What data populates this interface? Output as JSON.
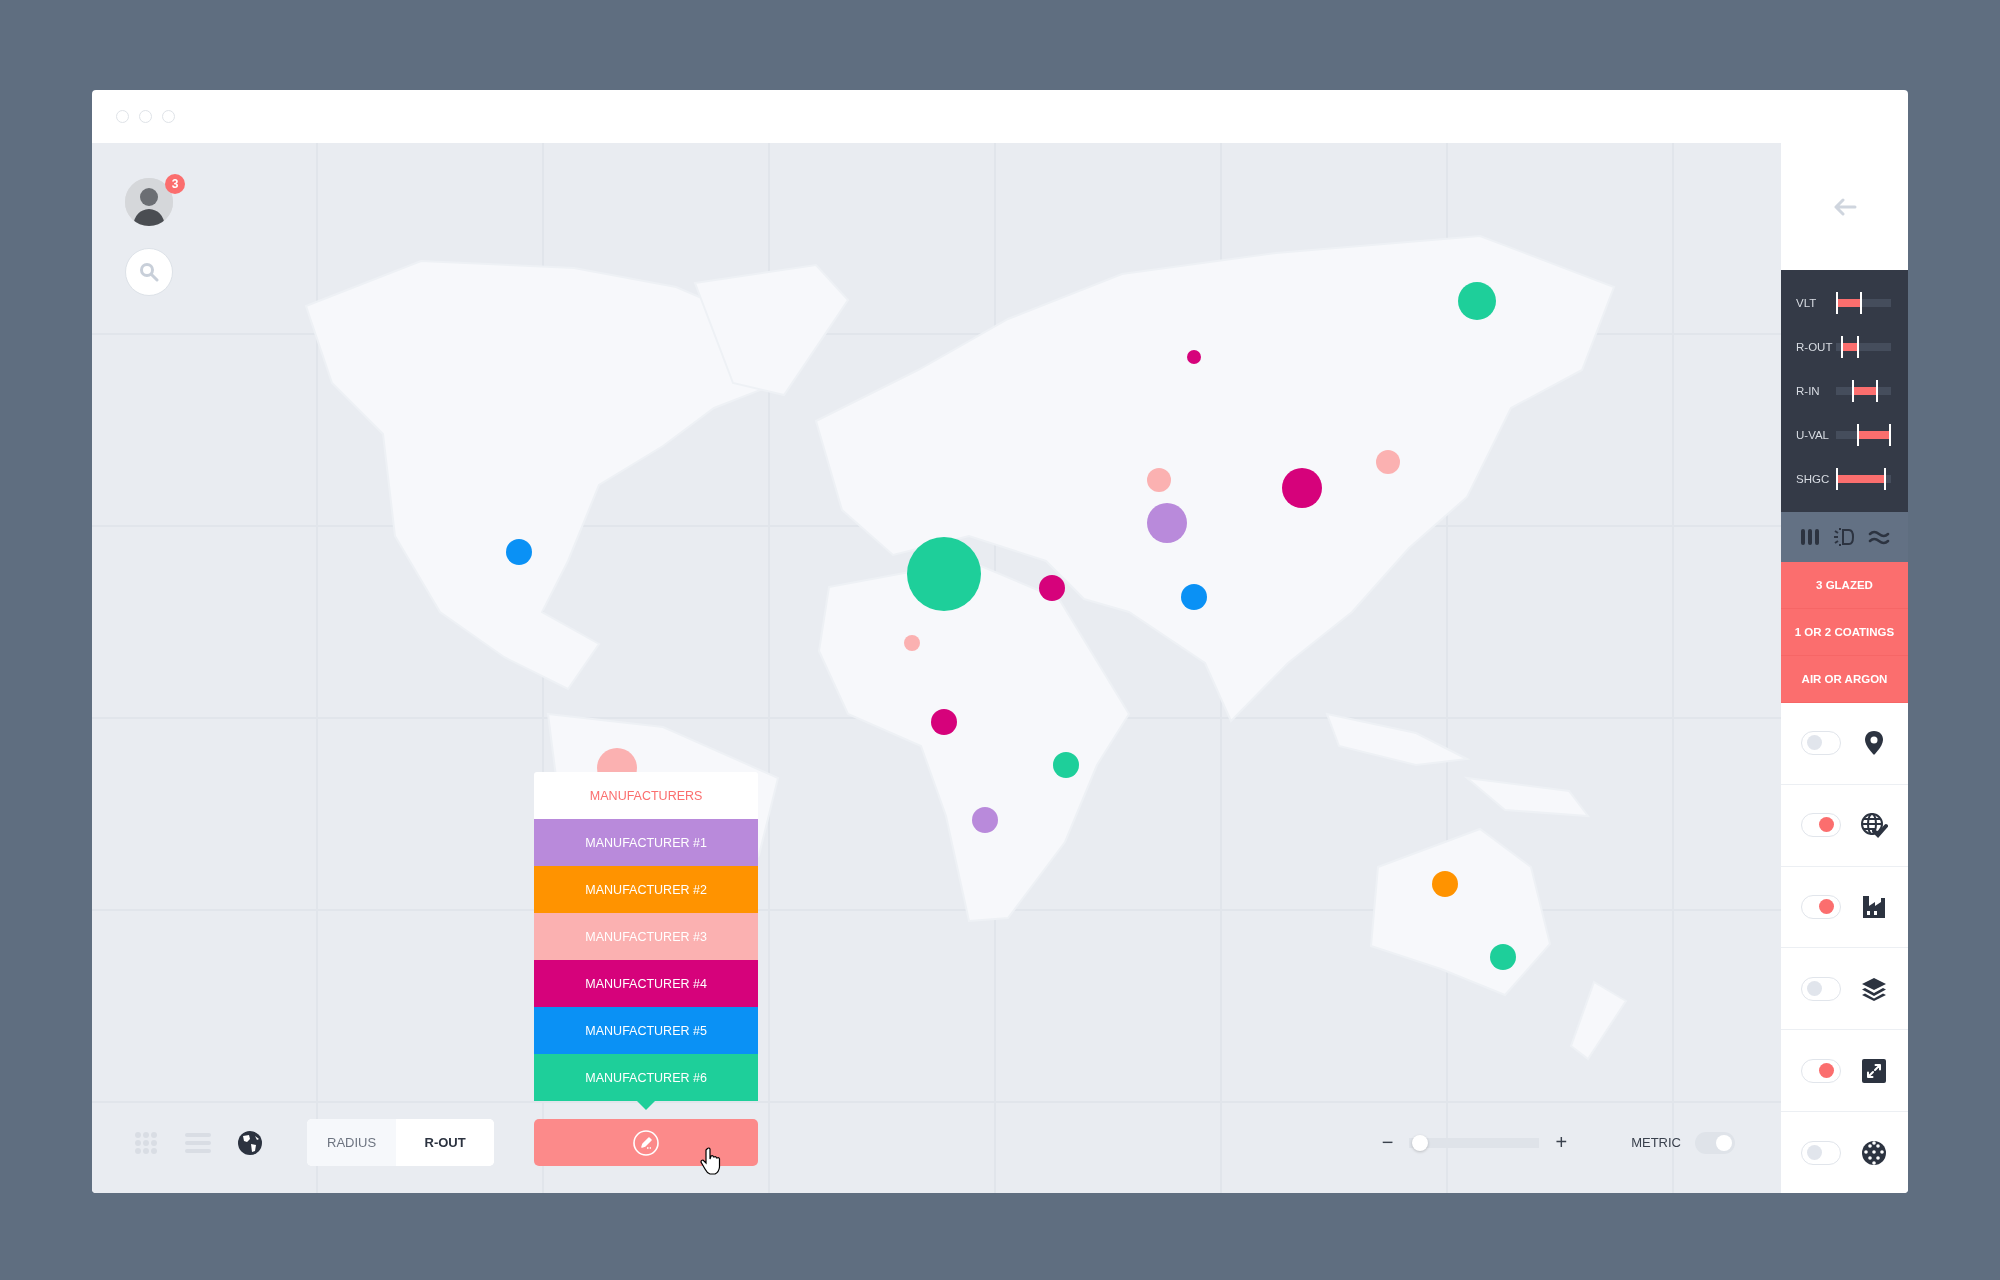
{
  "user": {
    "badge": "3"
  },
  "map": {
    "bubbles": [
      {
        "color": "#1ecf9a"
      },
      {
        "color": "#d6027b"
      },
      {
        "color": "#fbb1b1"
      },
      {
        "color": "#b98adb"
      },
      {
        "color": "#d6027b"
      },
      {
        "color": "#fbb1b1"
      },
      {
        "color": "#0a91f5"
      },
      {
        "color": "#1ecf9a"
      },
      {
        "color": "#d6027b"
      },
      {
        "color": "#0a91f5"
      },
      {
        "color": "#fbb1b1"
      },
      {
        "color": "#d6027b"
      },
      {
        "color": "#1ecf9a"
      },
      {
        "color": "#b98adb"
      },
      {
        "color": "#ff9300"
      },
      {
        "color": "#1ecf9a"
      },
      {
        "color": "#fbb1b1"
      }
    ]
  },
  "legend": {
    "title": "MANUFACTURERS",
    "items": [
      {
        "label": "MANUFACTURER #1",
        "color": "#b98adb"
      },
      {
        "label": "MANUFACTURER #2",
        "color": "#ff9300"
      },
      {
        "label": "MANUFACTURER #3",
        "color": "#fbb1b1"
      },
      {
        "label": "MANUFACTURER #4",
        "color": "#d6027b"
      },
      {
        "label": "MANUFACTURER #5",
        "color": "#0a91f5"
      },
      {
        "label": "MANUFACTURER #6",
        "color": "#1ecf9a"
      }
    ]
  },
  "view_buttons": [
    {
      "kind": "grid",
      "selected": false
    },
    {
      "kind": "list",
      "selected": false
    },
    {
      "kind": "globe",
      "selected": true
    }
  ],
  "segments": [
    {
      "label": "RADIUS",
      "selected": false
    },
    {
      "label": "R-OUT",
      "selected": true
    }
  ],
  "zoom": {
    "minus": "−",
    "plus": "+",
    "level": 0.05
  },
  "metric": {
    "label": "METRIC",
    "on": true
  },
  "filters": [
    {
      "label": "VLT",
      "handles": [
        {
          "level": 0.0
        },
        {
          "level": 0.45
        }
      ]
    },
    {
      "label": "R-OUT",
      "handles": [
        {
          "level": 0.1
        },
        {
          "level": 0.4
        }
      ]
    },
    {
      "label": "R-IN",
      "handles": [
        {
          "level": 0.3
        },
        {
          "level": 0.75
        }
      ]
    },
    {
      "label": "U-VAL",
      "handles": [
        {
          "level": 0.4
        },
        {
          "level": 1.0
        }
      ]
    },
    {
      "label": "SHGC",
      "handles": [
        {
          "level": 0.0
        },
        {
          "level": 0.9
        }
      ]
    }
  ],
  "tool_icons": [
    {
      "kind": "columns"
    },
    {
      "kind": "light"
    },
    {
      "kind": "waves"
    }
  ],
  "options": [
    "3 GLAZED",
    "1 OR 2 COATINGS",
    "AIR OR ARGON"
  ],
  "layers": [
    {
      "kind": "pin",
      "on": false
    },
    {
      "kind": "globe-check",
      "on": true
    },
    {
      "kind": "factory",
      "on": true
    },
    {
      "kind": "layers",
      "on": false
    },
    {
      "kind": "expand",
      "on": true
    },
    {
      "kind": "mesh",
      "on": false
    }
  ]
}
